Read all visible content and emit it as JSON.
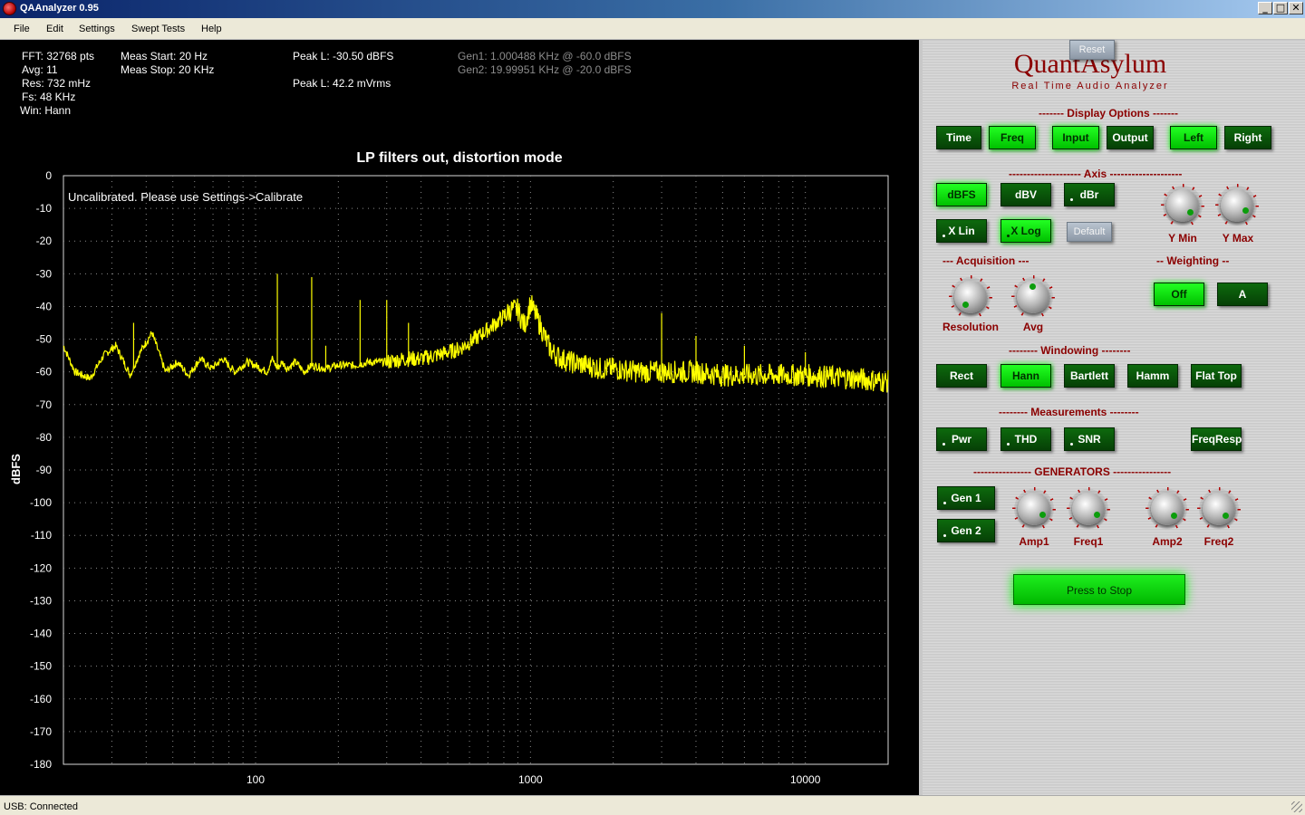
{
  "window": {
    "title": "QAAnalyzer 0.95",
    "min": "_",
    "max": "□",
    "close": "✕"
  },
  "menu": [
    "File",
    "Edit",
    "Settings",
    "Swept Tests",
    "Help"
  ],
  "info": {
    "fft": "FFT: 32768 pts",
    "avg": "Avg: 11",
    "res": "Res: 732 mHz",
    "fs": "Fs: 48 KHz",
    "win": "Win: Hann",
    "meas_start": "Meas Start: 20 Hz",
    "meas_stop": "Meas Stop: 20 KHz",
    "peak_l_dbfs": "Peak L: -30.50 dBFS",
    "peak_l_vrms": "Peak L: 42.2 mVrms",
    "gen1": "Gen1: 1.000488 KHz @ -60.0 dBFS",
    "gen2": "Gen2: 19.99951 KHz @ -20.0 dBFS"
  },
  "plot": {
    "uncal": "Uncalibrated. Please use Settings->Calibrate",
    "trace_color": "#ffff00"
  },
  "chart_data": {
    "type": "line",
    "title": "LP filters out, distortion mode",
    "xlabel": "",
    "ylabel": "dBFS",
    "x_scale": "log",
    "xlim": [
      20,
      20000
    ],
    "ylim": [
      -180,
      0
    ],
    "y_ticks": [
      0,
      -10,
      -20,
      -30,
      -40,
      -50,
      -60,
      -70,
      -80,
      -90,
      -100,
      -110,
      -120,
      -130,
      -140,
      -150,
      -160,
      -170,
      -180
    ],
    "x_ticks": [
      100,
      1000,
      10000
    ],
    "grid": true,
    "series": [
      {
        "color": "#ffff00",
        "x": [
          20,
          22,
          25,
          28,
          31,
          35,
          38,
          42,
          47,
          52,
          57,
          63,
          69,
          76,
          84,
          93,
          100,
          110,
          115,
          120,
          125,
          130,
          140,
          150,
          160,
          180,
          200,
          230,
          260,
          300,
          350,
          400,
          450,
          500,
          550,
          600,
          650,
          700,
          750,
          800,
          850,
          900,
          950,
          1000,
          1050,
          1100,
          1150,
          1200,
          1300,
          1400,
          1600,
          1800,
          2000,
          2500,
          3000,
          4000,
          5000,
          7000,
          10000,
          15000,
          20000
        ],
        "y": [
          -52,
          -60,
          -62,
          -55,
          -52,
          -61,
          -54,
          -48,
          -60,
          -57,
          -61,
          -56,
          -59,
          -56,
          -60,
          -57,
          -58,
          -60,
          -56,
          -59,
          -57,
          -59,
          -57,
          -60,
          -58,
          -59,
          -58,
          -58,
          -57,
          -57,
          -56,
          -56,
          -55,
          -54,
          -53,
          -51,
          -49,
          -47,
          -45,
          -43,
          -41,
          -41,
          -46,
          -39,
          -43,
          -47,
          -51,
          -54,
          -56,
          -57,
          -58,
          -59,
          -59,
          -60,
          -60,
          -60,
          -61,
          -61,
          -61,
          -62,
          -63
        ]
      }
    ],
    "spikes": [
      {
        "x": 36,
        "y": -45
      },
      {
        "x": 120,
        "y": -30
      },
      {
        "x": 160,
        "y": -31
      },
      {
        "x": 180,
        "y": -52
      },
      {
        "x": 240,
        "y": -38
      },
      {
        "x": 300,
        "y": -38
      },
      {
        "x": 360,
        "y": -45
      },
      {
        "x": 3000,
        "y": -42
      },
      {
        "x": 4000,
        "y": -49
      },
      {
        "x": 6000,
        "y": -52
      },
      {
        "x": 10000,
        "y": -54
      }
    ]
  },
  "panel": {
    "brand": "QuantAsylum",
    "tagline": "Real Time Audio Analyzer",
    "display_options": "------- Display Options -------",
    "axis": "-------------------- Axis --------------------",
    "acquisition": "--- Acquisition ---",
    "weighting": "-- Weighting --",
    "windowing": "-------- Windowing --------",
    "measurements": "-------- Measurements --------",
    "generators": "---------------- GENERATORS ----------------",
    "display_buttons": [
      "Time",
      "Freq",
      "Input",
      "Output",
      "Left",
      "Right"
    ],
    "axis_buttons": [
      "dBFS",
      "dBV",
      "dBr"
    ],
    "xscale_buttons": [
      "X Lin",
      "X Log"
    ],
    "default_button": "Default",
    "reset_button": "Reset",
    "weight_buttons": [
      "Off",
      "A"
    ],
    "window_buttons": [
      "Rect",
      "Hann",
      "Bartlett",
      "Hamm",
      "Flat Top"
    ],
    "measure_buttons": [
      "Pwr",
      "THD",
      "SNR",
      "FreqResp"
    ],
    "gen_buttons": [
      "Gen 1",
      "Gen 2"
    ],
    "knob_labels": {
      "ymin": "Y Min",
      "ymax": "Y Max",
      "resolution": "Resolution",
      "avg": "Avg",
      "amp1": "Amp1",
      "freq1": "Freq1",
      "amp2": "Amp2",
      "freq2": "Freq2"
    },
    "stop_button": "Press to Stop",
    "accent_dark_green": "#064006",
    "accent_bright_green": "#00ff00",
    "label_color": "#8b0000"
  },
  "status": "USB: Connected"
}
